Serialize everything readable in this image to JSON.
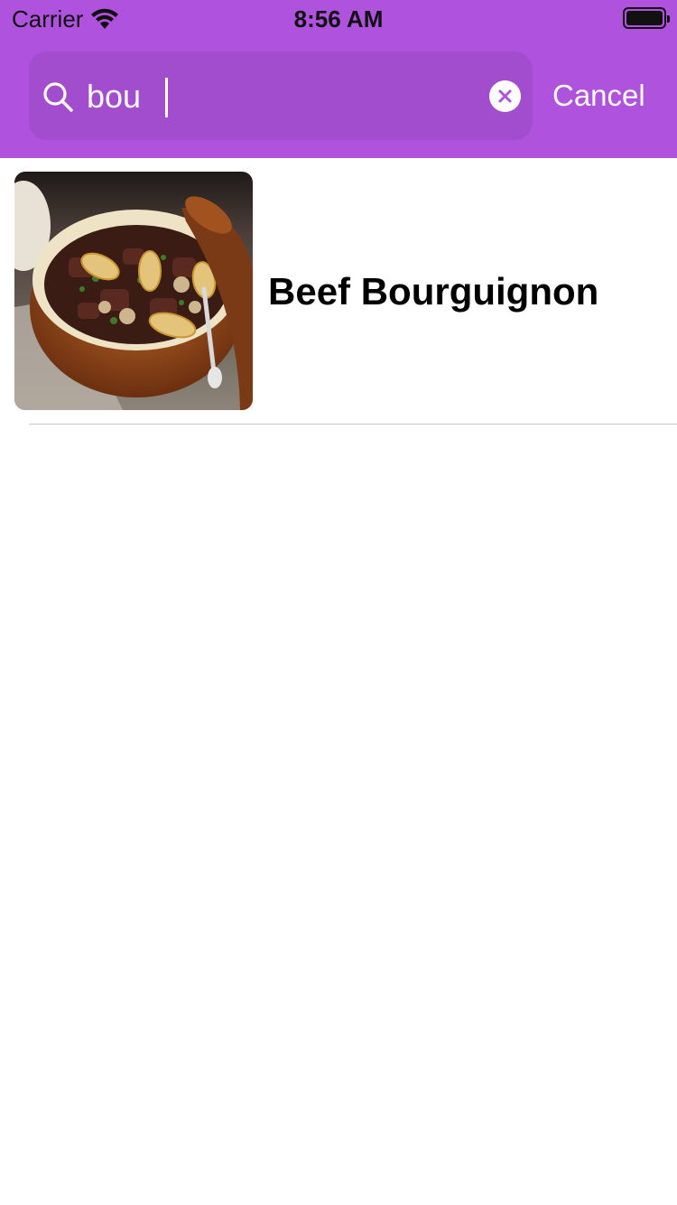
{
  "status_bar": {
    "carrier": "Carrier",
    "time": "8:56 AM",
    "wifi_icon": "wifi-icon",
    "battery_icon": "battery-icon"
  },
  "theme": {
    "header_color": "#af52de",
    "text_on_header": "#ffffff"
  },
  "search": {
    "value": "bou",
    "search_icon": "search-icon",
    "clear_icon": "clear-icon",
    "cancel_label": "Cancel"
  },
  "results": [
    {
      "title": "Beef Bourguignon",
      "image": "beef-bourguignon-photo"
    }
  ]
}
